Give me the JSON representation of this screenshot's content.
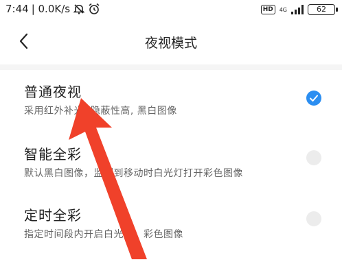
{
  "status_bar": {
    "time": "7:44",
    "speed": "| 0.0K/s",
    "hd_label": "HD",
    "network_label": "4G",
    "battery": "62"
  },
  "header": {
    "title": "夜视模式"
  },
  "options": [
    {
      "title": "普通夜视",
      "desc": "采用红外补光, 隐蔽性高, 黑白图像",
      "selected": true
    },
    {
      "title": "智能全彩",
      "desc": "默认黑白图像，监测到移动时白光灯打开彩色图像",
      "selected": false
    },
    {
      "title": "定时全彩",
      "desc": "指定时间段内开启白光灯，彩色图像",
      "selected": false
    }
  ],
  "colors": {
    "accent": "#2b8ef1",
    "annotation_arrow": "#f0412a"
  }
}
